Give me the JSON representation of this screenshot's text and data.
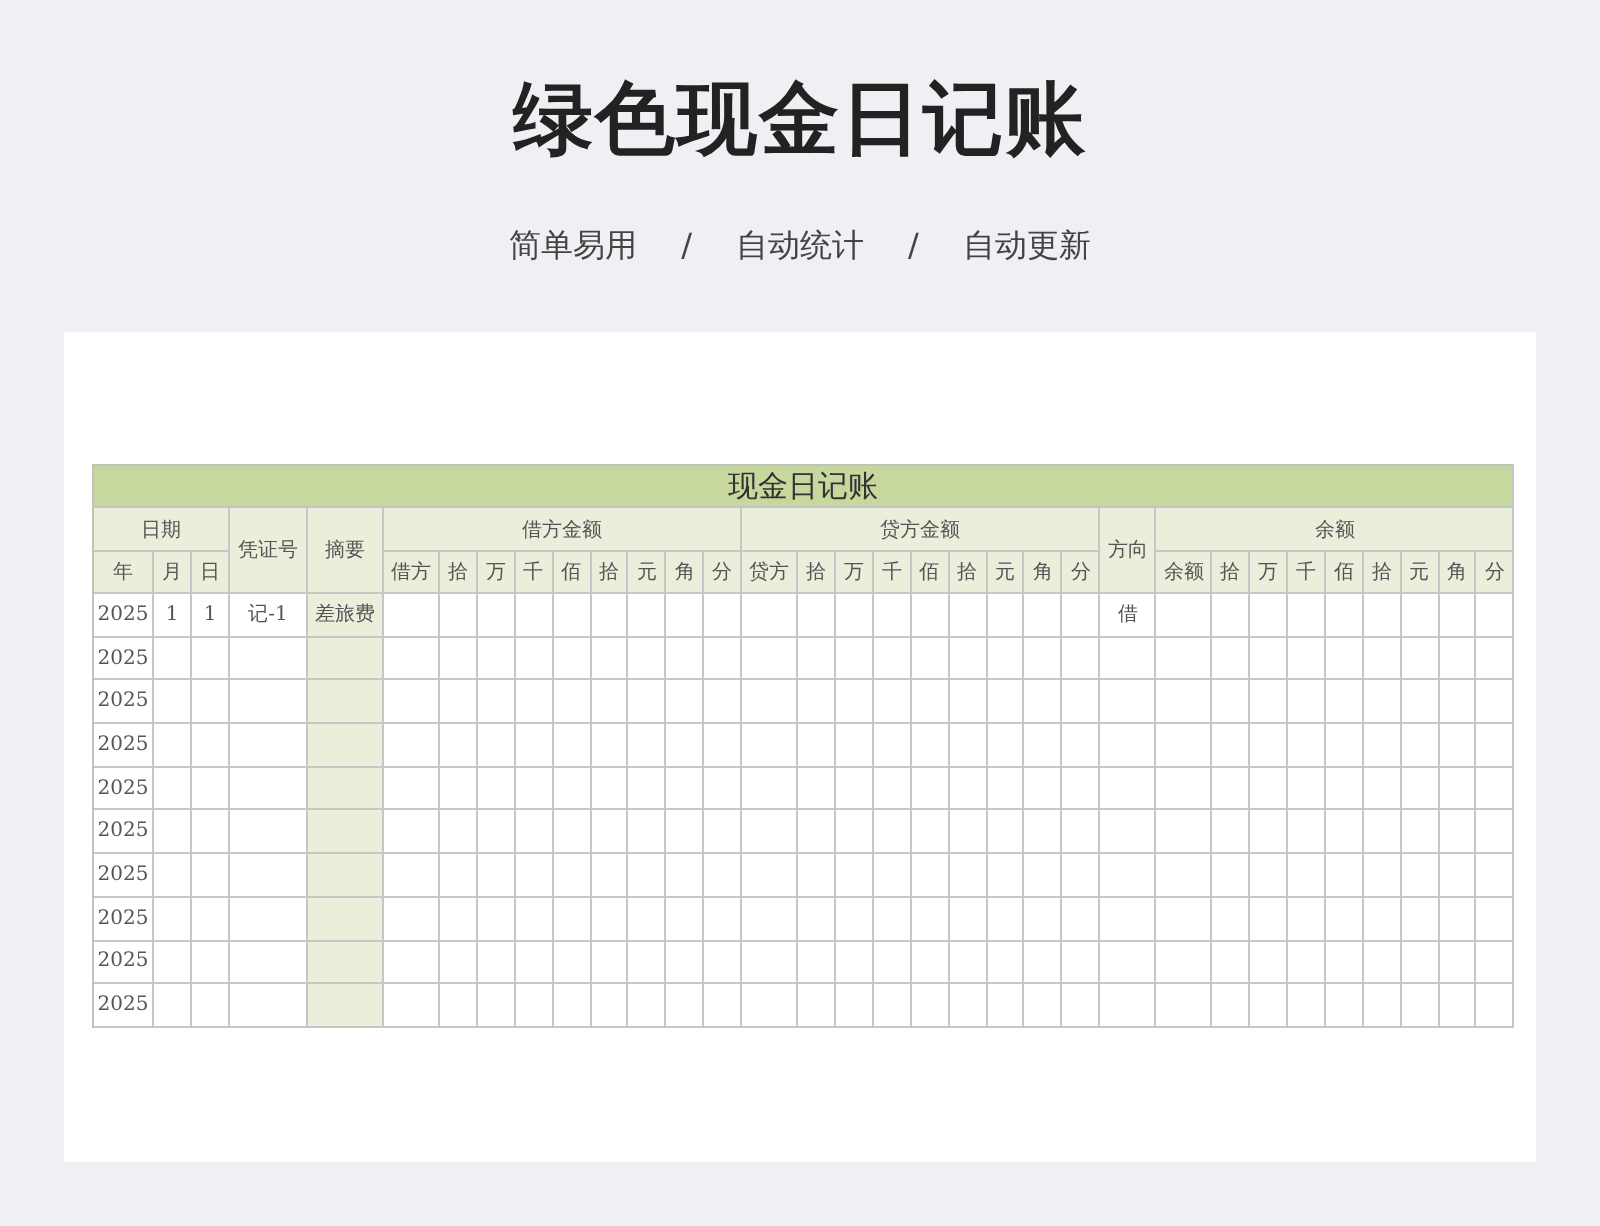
{
  "title": "绿色现金日记账",
  "tagline": [
    "简单易用",
    "/",
    "自动统计",
    "/",
    "自动更新"
  ],
  "sheet": {
    "title": "现金日记账",
    "header_groups": [
      {
        "label": "日期",
        "columns": [
          "年",
          "月",
          "日"
        ]
      },
      {
        "label": "凭证号"
      },
      {
        "label": "摘要"
      },
      {
        "label": "借方金额",
        "columns": [
          "借方",
          "拾",
          "万",
          "千",
          "佰",
          "拾",
          "元",
          "角",
          "分"
        ]
      },
      {
        "label": "贷方金额",
        "columns": [
          "贷方",
          "拾",
          "万",
          "千",
          "佰",
          "拾",
          "元",
          "角",
          "分"
        ]
      },
      {
        "label": "方向"
      },
      {
        "label": "余额",
        "columns": [
          "余额",
          "拾",
          "万",
          "千",
          "佰",
          "拾",
          "元",
          "角",
          "分"
        ]
      }
    ],
    "rows": [
      {
        "year": "2025",
        "month": "1",
        "day": "1",
        "voucher": "记-1",
        "summary": "差旅费",
        "direction": "借"
      },
      {
        "year": "2025"
      },
      {
        "year": "2025"
      },
      {
        "year": "2025"
      },
      {
        "year": "2025"
      },
      {
        "year": "2025"
      },
      {
        "year": "2025"
      },
      {
        "year": "2025"
      },
      {
        "year": "2025"
      },
      {
        "year": "2025"
      }
    ]
  }
}
